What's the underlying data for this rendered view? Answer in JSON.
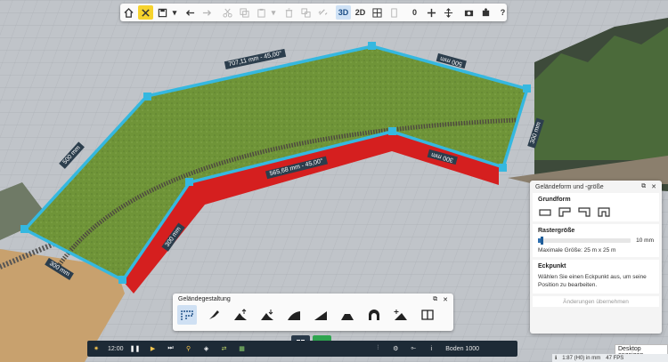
{
  "toolbar": {
    "items": [
      {
        "id": "home",
        "icon": "home-icon"
      },
      {
        "id": "tools",
        "icon": "tools-icon",
        "active": true
      },
      {
        "id": "save",
        "icon": "save-icon"
      },
      {
        "id": "undo",
        "icon": "undo-icon"
      },
      {
        "id": "redo",
        "icon": "redo-icon"
      },
      {
        "id": "cut",
        "icon": "cut-icon"
      },
      {
        "id": "copy",
        "icon": "copy-icon"
      },
      {
        "id": "paste",
        "icon": "paste-icon"
      },
      {
        "id": "delete",
        "icon": "delete-icon"
      },
      {
        "id": "group",
        "icon": "group-icon"
      },
      {
        "id": "link",
        "icon": "link-icon"
      }
    ],
    "view_3d": "3D",
    "view_2d": "2D",
    "counter": "0",
    "help": "?"
  },
  "dimensions": {
    "top_diag": "707,11 mm - 45,00°",
    "top_right": "500 mm",
    "left": "500 mm",
    "right": "300 mm",
    "inner_diag": "565,68 mm - 45,00°",
    "inner_right": "300 mm",
    "inner_left": "300 mm",
    "bottom_left": "300 mm"
  },
  "panel": {
    "title": "Geländeform und -größe",
    "grundform": "Grundform",
    "rastergroesse": "Rastergröße",
    "slider_value": "10 mm",
    "slider_fraction": 0.04,
    "max_size": "Maximale Größe: 25 m x 25 m",
    "eckpunkt": "Eckpunkt",
    "eckpunkt_text": "Wählen Sie einen Eckpunkt aus, um seine Position zu bearbeiten.",
    "apply": "Änderungen übernehmen"
  },
  "gelaende": {
    "title": "Geländegestaltung"
  },
  "status": {
    "time": "12:00",
    "layer": "Boden 1000",
    "scale": "1:87 (H0) in mm",
    "fps": "47 FPS"
  },
  "tooltip": "Desktop anzeigen",
  "colors": {
    "selection": "#35b8e0",
    "terrain": "#6a8f3a",
    "cliff": "#d51f1f",
    "accent": "#f6d32d"
  }
}
